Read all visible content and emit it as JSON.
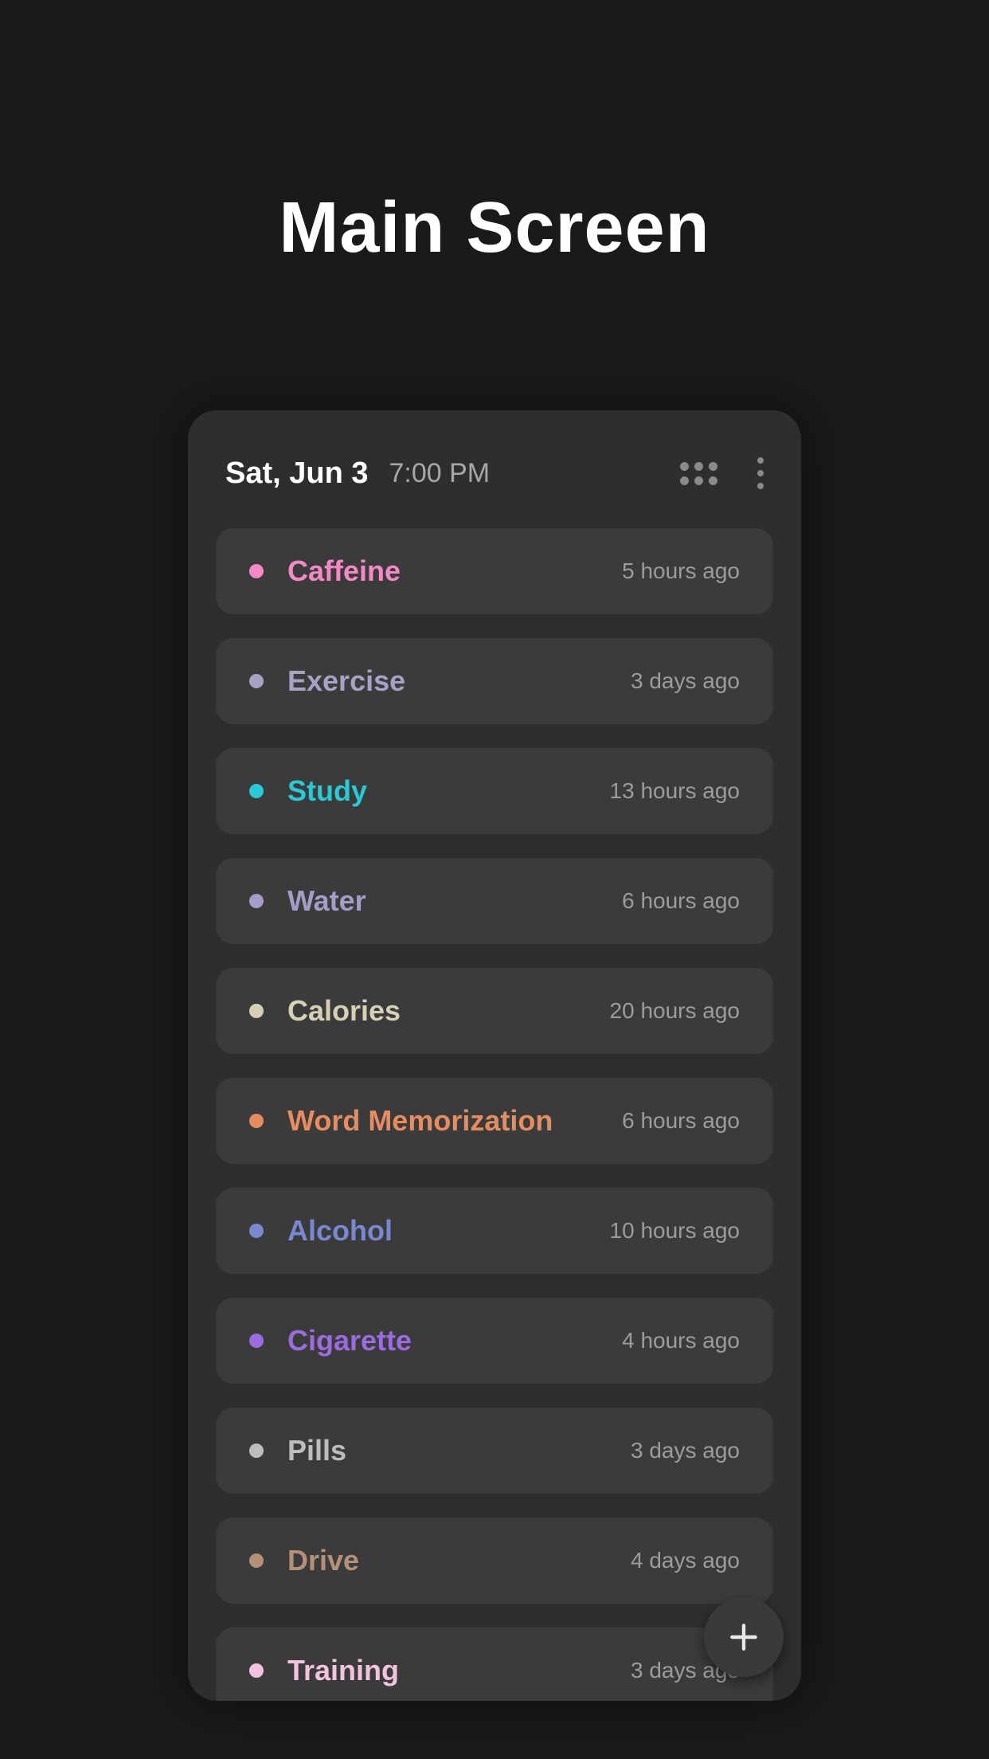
{
  "page": {
    "title": "Main Screen"
  },
  "header": {
    "date": "Sat, Jun 3",
    "time": "7:00 PM"
  },
  "items": [
    {
      "label": "Caffeine",
      "time": "5 hours ago",
      "color": "#f389c5"
    },
    {
      "label": "Exercise",
      "time": "3 days ago",
      "color": "#a6a2c4"
    },
    {
      "label": "Study",
      "time": "13 hours ago",
      "color": "#29c9d6"
    },
    {
      "label": "Water",
      "time": "6 hours ago",
      "color": "#a79cc8"
    },
    {
      "label": "Calories",
      "time": "20 hours ago",
      "color": "#d6d0b4"
    },
    {
      "label": "Word Memorization",
      "time": "6 hours ago",
      "color": "#e78b60"
    },
    {
      "label": "Alcohol",
      "time": "10 hours ago",
      "color": "#7a87d1"
    },
    {
      "label": "Cigarette",
      "time": "4 hours ago",
      "color": "#9b6be0"
    },
    {
      "label": "Pills",
      "time": "3 days ago",
      "color": "#bdbdbd"
    },
    {
      "label": "Drive",
      "time": "4 days ago",
      "color": "#b39077"
    },
    {
      "label": "Training",
      "time": "3 days ago",
      "color": "#f1c3de"
    }
  ]
}
